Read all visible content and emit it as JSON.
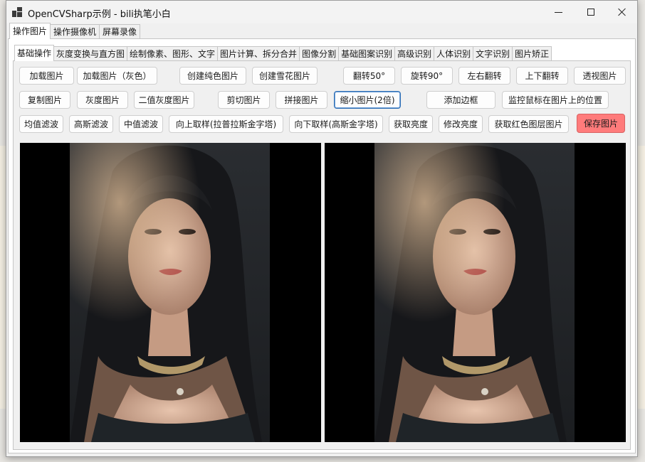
{
  "window": {
    "title": "OpenCVSharp示例 - bili执笔小白"
  },
  "outer_tabs": [
    "操作图片",
    "操作摄像机",
    "屏幕录像"
  ],
  "inner_tabs": [
    "基础操作",
    "灰度变换与直方图",
    "绘制像素、图形、文字",
    "图片计算、拆分合并",
    "图像分割",
    "基础图案识别",
    "高级识别",
    "人体识别",
    "文字识别",
    "图片矫正"
  ],
  "buttons": {
    "row1": [
      "加载图片",
      "加载图片（灰色）",
      "创建纯色图片",
      "创建雪花图片",
      "翻转50°",
      "旋转90°",
      "左右翻转",
      "上下翻转",
      "透视图片"
    ],
    "row2": [
      "复制图片",
      "灰度图片",
      "二值灰度图片",
      "剪切图片",
      "拼接图片",
      "缩小图片(2倍)",
      "添加边框",
      "监控鼠标在图片上的位置"
    ],
    "row3": [
      "均值滤波",
      "高斯滤波",
      "中值滤波",
      "向上取样(拉普拉斯金字塔)",
      "向下取样(高斯金字塔)",
      "获取亮度",
      "修改亮度",
      "获取红色图层图片",
      "保存图片"
    ]
  },
  "colors": {
    "save_button": "#ff7b7b",
    "focus_border": "#2f6fb5",
    "picture_background": "#000000"
  }
}
